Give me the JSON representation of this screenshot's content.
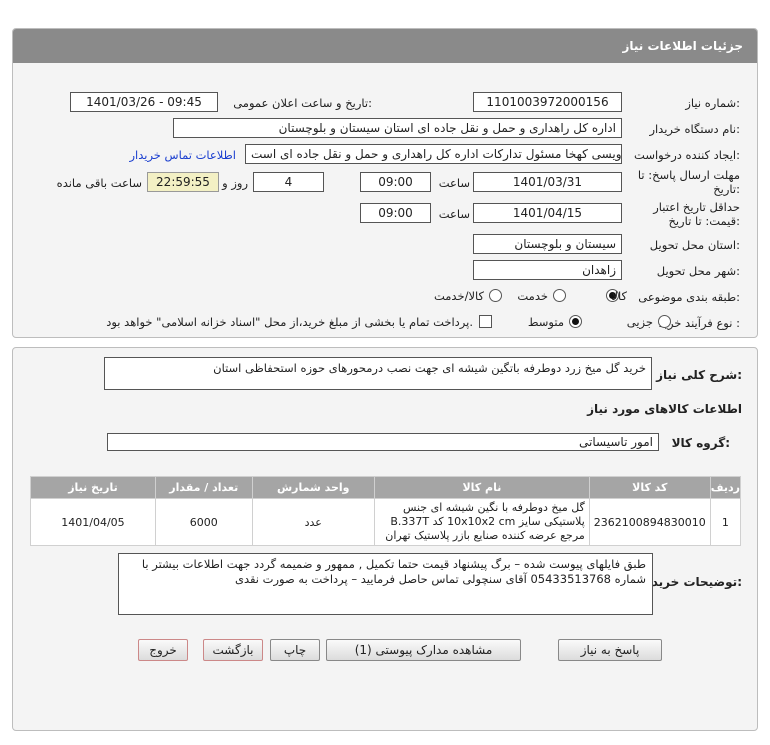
{
  "header": {
    "title": "جزئیات اطلاعات نیاز"
  },
  "fields": {
    "need_number_label": "شماره نیاز:",
    "need_number": "1101003972000156",
    "announce_label": "تاریخ و ساعت اعلان عمومی:",
    "announce_value": "1401/03/26 - 09:45",
    "buyer_org_label": "نام دستگاه خریدار:",
    "buyer_org": "اداره کل راهداری و حمل و نقل جاده ای استان سیستان و بلوچستان",
    "creator_label": "ایجاد کننده درخواست:",
    "creator": "علی اویسی کهخا مسئول تدارکات اداره کل راهداری و حمل و نقل جاده ای است",
    "contact_link": "اطلاعات تماس خریدار",
    "deadline_label_1": "مهلت ارسال پاسخ: تا",
    "deadline_label_2": "تاریخ:",
    "deadline_date": "1401/03/31",
    "time_label": "ساعت",
    "deadline_time": "09:00",
    "days_value": "4",
    "days_label": "روز و",
    "remaining_time": "22:59:55",
    "remaining_label": "ساعت باقی مانده",
    "validity_label_1": "حداقل تاریخ اعتبار",
    "validity_label_2": "قیمت: تا تاریخ:",
    "validity_date": "1401/04/15",
    "validity_time": "09:00",
    "province_label": "استان محل تحویل:",
    "province": "سیستان و بلوچستان",
    "city_label": "شهر محل تحویل:",
    "city": "زاهدان",
    "category_label": "طبقه بندی موضوعی:",
    "category_options": [
      "کالا",
      "خدمت",
      "کالا/خدمت"
    ],
    "process_label": "نوع فرآیند خرید :",
    "process_options": [
      "جزیی",
      "متوسط"
    ],
    "payment_note": "پرداخت تمام یا بخشی از مبلغ خرید،از محل \"اسناد خزانه اسلامی\" خواهد بود."
  },
  "summary": {
    "label": "شرح کلی نیاز:",
    "value": "خرید گل میخ زرد دوطرفه باتگین شیشه ای جهت نصب درمحورهای حوزه استحفاظی استان"
  },
  "goods_section_title": "اطلاعات کالاهای مورد نیاز",
  "goods_group": {
    "label": "گروه کالا:",
    "value": "امور تاسیساتی"
  },
  "table": {
    "headers": [
      "ردیف",
      "کد کالا",
      "نام کالا",
      "واحد شمارش",
      "تعداد / مقدار",
      "تاریخ نیاز"
    ],
    "rows": [
      {
        "index": "1",
        "code": "2362100894830010",
        "name": "گل میخ دوطرفه با نگین شیشه ای جنس پلاستیکی سایز 10x10x2 cm کد B.337T مرجع عرضه کننده صنایع بازر پلاستیک تهران",
        "unit": "عدد",
        "qty": "6000",
        "date": "1401/04/05"
      }
    ]
  },
  "buyer_notes": {
    "label": "توضیحات خریدار:",
    "value": "طبق فایلهای پیوست شده – برگ پیشنهاد قیمت حتما تکمیل , ممهور و ضمیمه گردد جهت اطلاعات بیشتر با شماره 05433513768 آقای سنچولی تماس حاصل فرمایید – پرداخت به صورت نقدی"
  },
  "buttons": {
    "reply": "پاسخ به نیاز",
    "attachments": "مشاهده مدارک پیوستی (1)",
    "print": "چاپ",
    "back": "بازگشت",
    "exit": "خروج"
  },
  "colors": {
    "titlebar": "#8a8a8a",
    "link": "#1a3ecf",
    "highlight": "#f3f0c4"
  }
}
